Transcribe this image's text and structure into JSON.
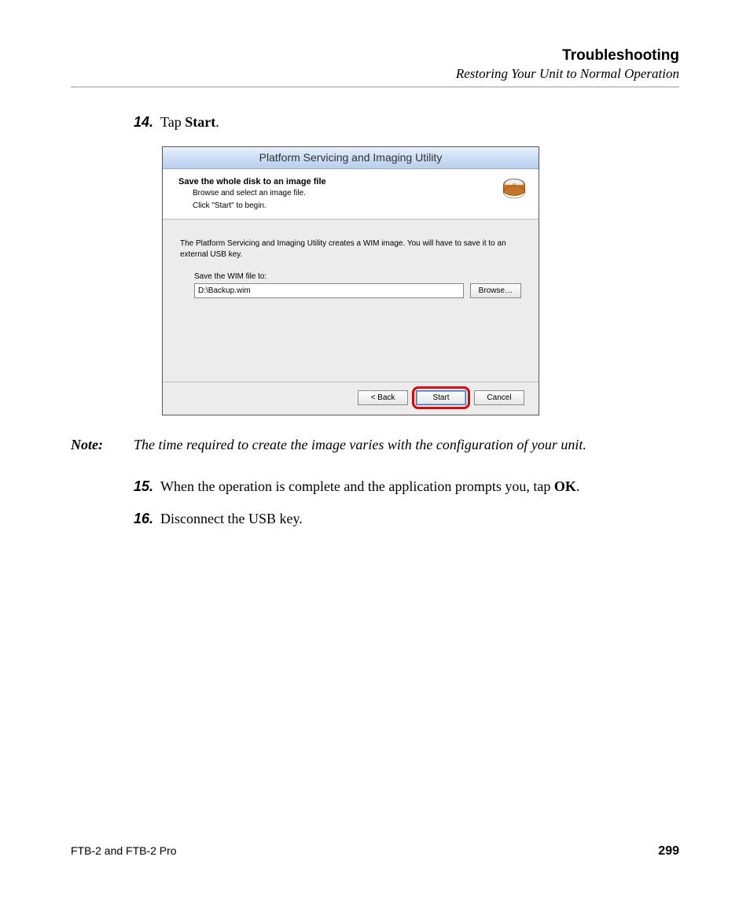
{
  "header": {
    "title": "Troubleshooting",
    "subtitle": "Restoring Your Unit to Normal Operation"
  },
  "steps": {
    "s14": {
      "num": "14.",
      "pre": "Tap ",
      "bold": "Start",
      "post": "."
    },
    "s15": {
      "num": "15.",
      "pre": "When the operation is complete and the application prompts you, tap ",
      "bold": "OK",
      "post": "."
    },
    "s16": {
      "num": "16.",
      "text": "Disconnect the USB key."
    }
  },
  "note": {
    "label": "Note:",
    "text": "The time required to create the image varies with the configuration of your unit."
  },
  "dialog": {
    "title": "Platform Servicing and Imaging Utility",
    "head_main": "Save the whole disk to an image file",
    "head_sub1": "Browse and select an image file.",
    "head_sub2": "Click \"Start\" to begin.",
    "body_intro": "The Platform Servicing and Imaging Utility creates a WIM image. You will have to save it to an external USB key.",
    "field_label": "Save the WIM file to:",
    "field_value": "D:\\Backup.wim",
    "browse_label": "Browse…",
    "back_label": "< Back",
    "start_label": "Start",
    "cancel_label": "Cancel"
  },
  "footer": {
    "left": "FTB-2 and FTB-2 Pro",
    "right": "299"
  }
}
